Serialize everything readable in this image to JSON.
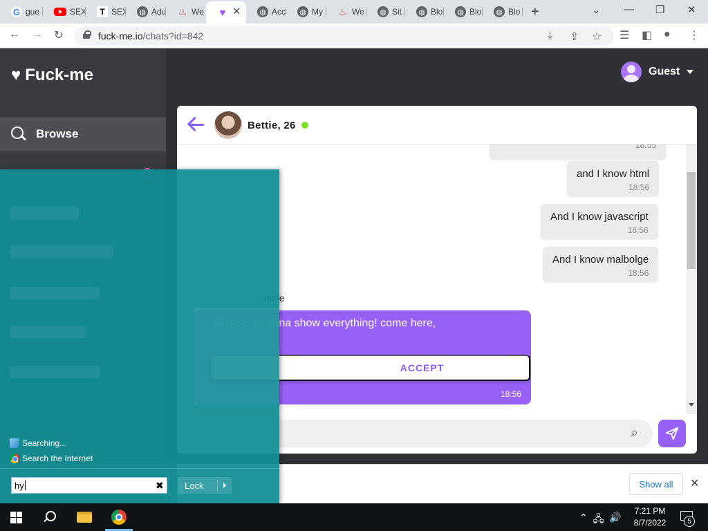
{
  "browser": {
    "tabs": [
      {
        "label": "gue",
        "icon": "google-icon"
      },
      {
        "label": "SEX",
        "icon": "youtube-icon"
      },
      {
        "label": "SEX",
        "icon": "t-icon"
      },
      {
        "label": "Adu",
        "icon": "globe-icon"
      },
      {
        "label": "We",
        "icon": "fire-icon"
      },
      {
        "label": "",
        "icon": "heart-icon",
        "active": true
      },
      {
        "label": "Acc",
        "icon": "globe-icon"
      },
      {
        "label": "My",
        "icon": "globe-icon"
      },
      {
        "label": "We",
        "icon": "fire-icon"
      },
      {
        "label": "Sit",
        "icon": "globe-icon"
      },
      {
        "label": "Blo",
        "icon": "globe-icon"
      },
      {
        "label": "Blo",
        "icon": "globe-icon"
      },
      {
        "label": "Blo",
        "icon": "globe-icon"
      }
    ],
    "url_host": "fuck-me.io",
    "url_path": "/chats?id=842"
  },
  "site": {
    "logo": "Fuck-me",
    "nav_browse": "Browse",
    "user_name": "Guest"
  },
  "chat": {
    "contact": "Bettie, 26",
    "messages": [
      {
        "text": "",
        "time": "18:55"
      },
      {
        "text": "and I know html",
        "time": "18:56"
      },
      {
        "text": "And I know javascript",
        "time": "18:56"
      },
      {
        "text": "And I know malbolge",
        "time": "18:56"
      }
    ],
    "invite_label": "nvite",
    "invite_text": "please, i wanna show everything! come here,",
    "accept_label": "ACCEPT",
    "invite_time": "18:56"
  },
  "downloads": {
    "show_all": "Show all"
  },
  "start_menu": {
    "searching": "Searching...",
    "search_internet": "Search the Internet",
    "query": "hy",
    "lock_label": "Lock"
  },
  "taskbar": {
    "time": "7:21 PM",
    "date": "8/7/2022",
    "notifications": "5"
  },
  "colors": {
    "accent": "#9761f7",
    "start_menu": "#128e96",
    "online": "#7ee22a"
  }
}
